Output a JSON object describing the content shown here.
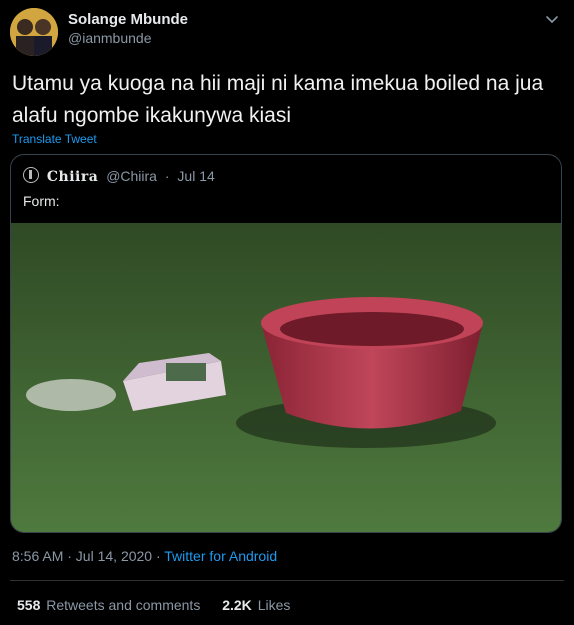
{
  "author": {
    "name": "Solange Mbunde",
    "handle": "@ianmbunde"
  },
  "tweet": {
    "text": "Utamu ya kuoga na hii maji ni kama imekua boiled na jua alafu ngombe ikakunywa kiasi",
    "translate_label": "Translate Tweet"
  },
  "quoted": {
    "name": "Chiira",
    "handle": "@Chiira",
    "separator": "·",
    "date": "Jul 14",
    "text": "Form:"
  },
  "meta": {
    "time": "8:56 AM · Jul 14, 2020 · ",
    "source": "Twitter for Android"
  },
  "stats": {
    "retweets_count": "558",
    "retweets_label": "Retweets and comments",
    "likes_count": "2.2K",
    "likes_label": "Likes"
  },
  "colors": {
    "link": "#1d9bf0",
    "bowl": "#b03a4c",
    "grass": "#4a6b3a"
  },
  "icons": [
    "chevron-down-icon",
    "quoted-avatar-icon"
  ]
}
